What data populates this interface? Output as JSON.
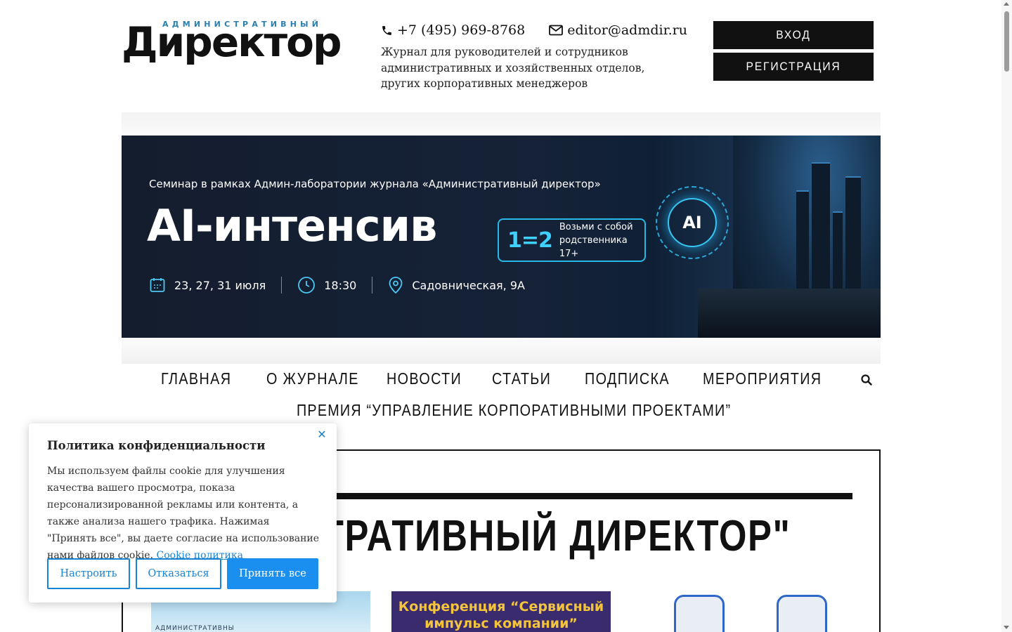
{
  "header": {
    "logo_small": "АДМИНИСТРАТИВНЫЙ",
    "logo_big": "Директор",
    "phone": "+7 (495) 969-8768",
    "email": "editor@admdir.ru",
    "tagline": "Журнал для руководителей и сотрудников административных и хозяйственных отделов, других корпоративных менеджеров",
    "login_label": "ВХОД",
    "register_label": "РЕГИСТРАЦИЯ"
  },
  "banner": {
    "subtitle": "Семинар в рамках Админ-лаборатории журнала «Административный директор»",
    "title": "AI-интенсив",
    "promo_big": "1=2",
    "promo_line1": "Возьми с собой",
    "promo_line2": "родственника 17+",
    "ai_label": "AI",
    "dates": "23, 27, 31 июля",
    "time": "18:30",
    "address": "Садовническая, 9А"
  },
  "nav": {
    "items": [
      "ГЛАВНАЯ",
      "О ЖУРНАЛЕ",
      "НОВОСТИ",
      "СТАТЬИ",
      "ПОДПИСКА",
      "МЕРОПРИЯТИЯ"
    ],
    "second_row": "ПРЕМИЯ “УПРАВЛЕНИЕ КОРПОРАТИВНЫМИ ПРОЕКТАМИ”",
    "search_icon": "search-icon"
  },
  "content": {
    "heading": "НИСТРАТИВНЫЙ ДИРЕКТОР\"",
    "thumb1_text": "АДМИНИСТРАТИВНЫ",
    "thumb2_line1": "Конференция “Сервисный",
    "thumb2_line2": "импульс компании”"
  },
  "cookie": {
    "title": "Политика конфиденциальности",
    "text": "Мы используем файлы cookie для улучшения качества вашего просмотра, показа персонализированной рекламы или контента, а также анализа нашего трафика. Нажимая \"Принять все\", вы даете согласие на использование нами файлов cookie.",
    "link": "Cookie политика",
    "customize_label": "Настроить",
    "decline_label": "Отказаться",
    "accept_label": "Принять все",
    "close_icon": "close-icon",
    "accent": "#1a8ff0"
  }
}
